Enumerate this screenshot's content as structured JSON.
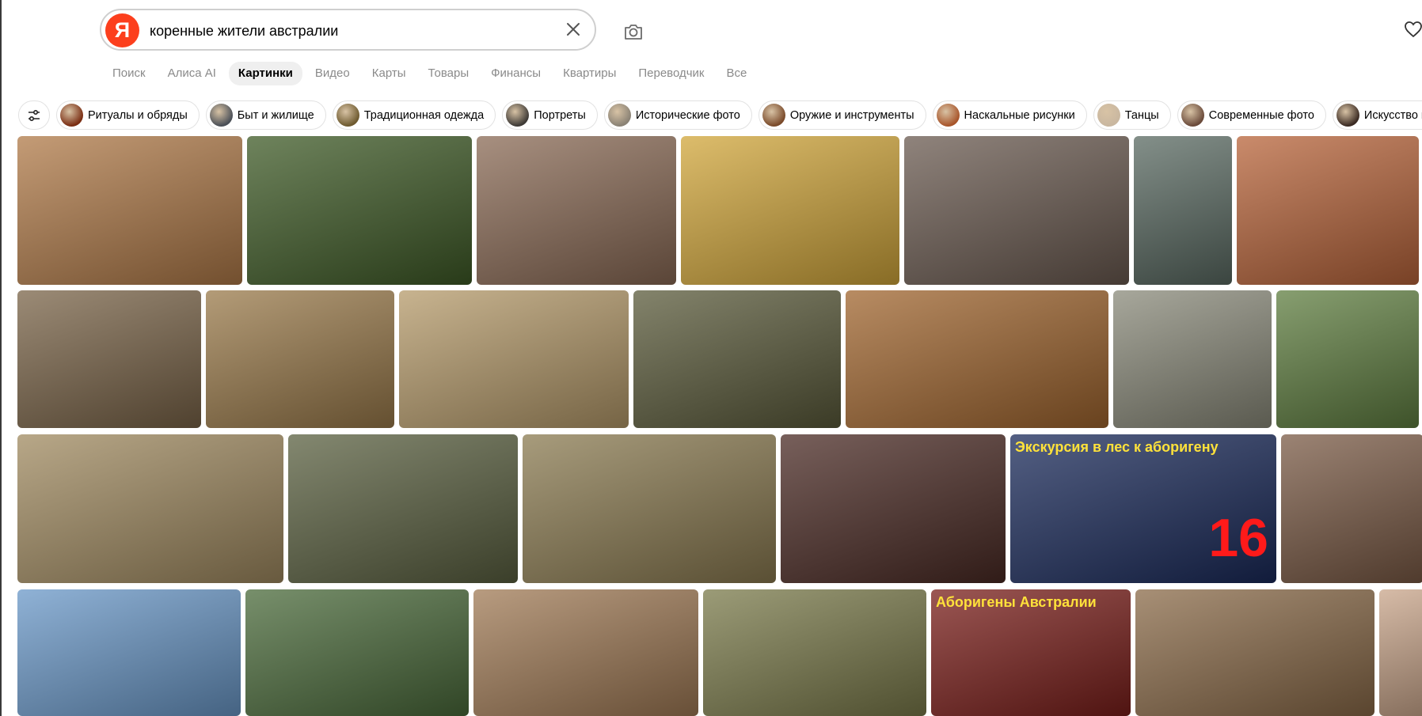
{
  "search": {
    "logo_letter": "Я",
    "query": "коренные жители австралии"
  },
  "tabs": [
    {
      "label": "Поиск",
      "active": false
    },
    {
      "label": "Алиса AI",
      "active": false
    },
    {
      "label": "Картинки",
      "active": true
    },
    {
      "label": "Видео",
      "active": false
    },
    {
      "label": "Карты",
      "active": false
    },
    {
      "label": "Товары",
      "active": false
    },
    {
      "label": "Финансы",
      "active": false
    },
    {
      "label": "Квартиры",
      "active": false
    },
    {
      "label": "Переводчик",
      "active": false
    },
    {
      "label": "Все",
      "active": false
    }
  ],
  "chips": [
    {
      "label": "Ритуалы и обряды",
      "color": "#7a2d12"
    },
    {
      "label": "Быт и жилище",
      "color": "#4a4f57"
    },
    {
      "label": "Традиционная одежда",
      "color": "#6e5a2f"
    },
    {
      "label": "Портреты",
      "color": "#3e3a36"
    },
    {
      "label": "Исторические фото",
      "color": "#8a8275"
    },
    {
      "label": "Оружие и инструменты",
      "color": "#7a4a2a"
    },
    {
      "label": "Наскальные рисунки",
      "color": "#a8552a"
    },
    {
      "label": "Танцы",
      "color": "#c9b7a0"
    },
    {
      "label": "Современные фото",
      "color": "#6a4a3a"
    },
    {
      "label": "Искусство и ремёсла",
      "color": "#3a2a22"
    }
  ],
  "images": {
    "row1": [
      {
        "color": "#b07a48"
      },
      {
        "color": "#3e5a26"
      },
      {
        "color": "#8a6a55"
      },
      {
        "color": "#d1a63a"
      },
      {
        "color": "#6a5a50"
      },
      {
        "color": "#5a6a62"
      },
      {
        "color": "#b8643a"
      }
    ],
    "row2": [
      {
        "color": "#7a6448"
      },
      {
        "color": "#9a7a4a"
      },
      {
        "color": "#b59a6a"
      },
      {
        "color": "#5a5a3a"
      },
      {
        "color": "#a0652e"
      },
      {
        "color": "#8a8a7a"
      },
      {
        "color": "#5f7e40"
      }
    ],
    "row3": [
      {
        "color": "#a08a60"
      },
      {
        "color": "#5a6040"
      },
      {
        "color": "#8a7a50"
      },
      {
        "color": "#4a2a24"
      },
      {
        "color": "#1a2a5a",
        "banner": "Экскурсия в лес к аборигену",
        "number": "16"
      },
      {
        "color": "#7a5a45"
      }
    ],
    "row4": [
      {
        "color": "#6a98c8"
      },
      {
        "color": "#4a6a3a"
      },
      {
        "color": "#a07a55"
      },
      {
        "color": "#7a7a4a"
      },
      {
        "color": "#7a1e1a",
        "banner": "Аборигены Австралии"
      },
      {
        "color": "#8a6a48"
      },
      {
        "color": "#c9a58a"
      }
    ]
  }
}
